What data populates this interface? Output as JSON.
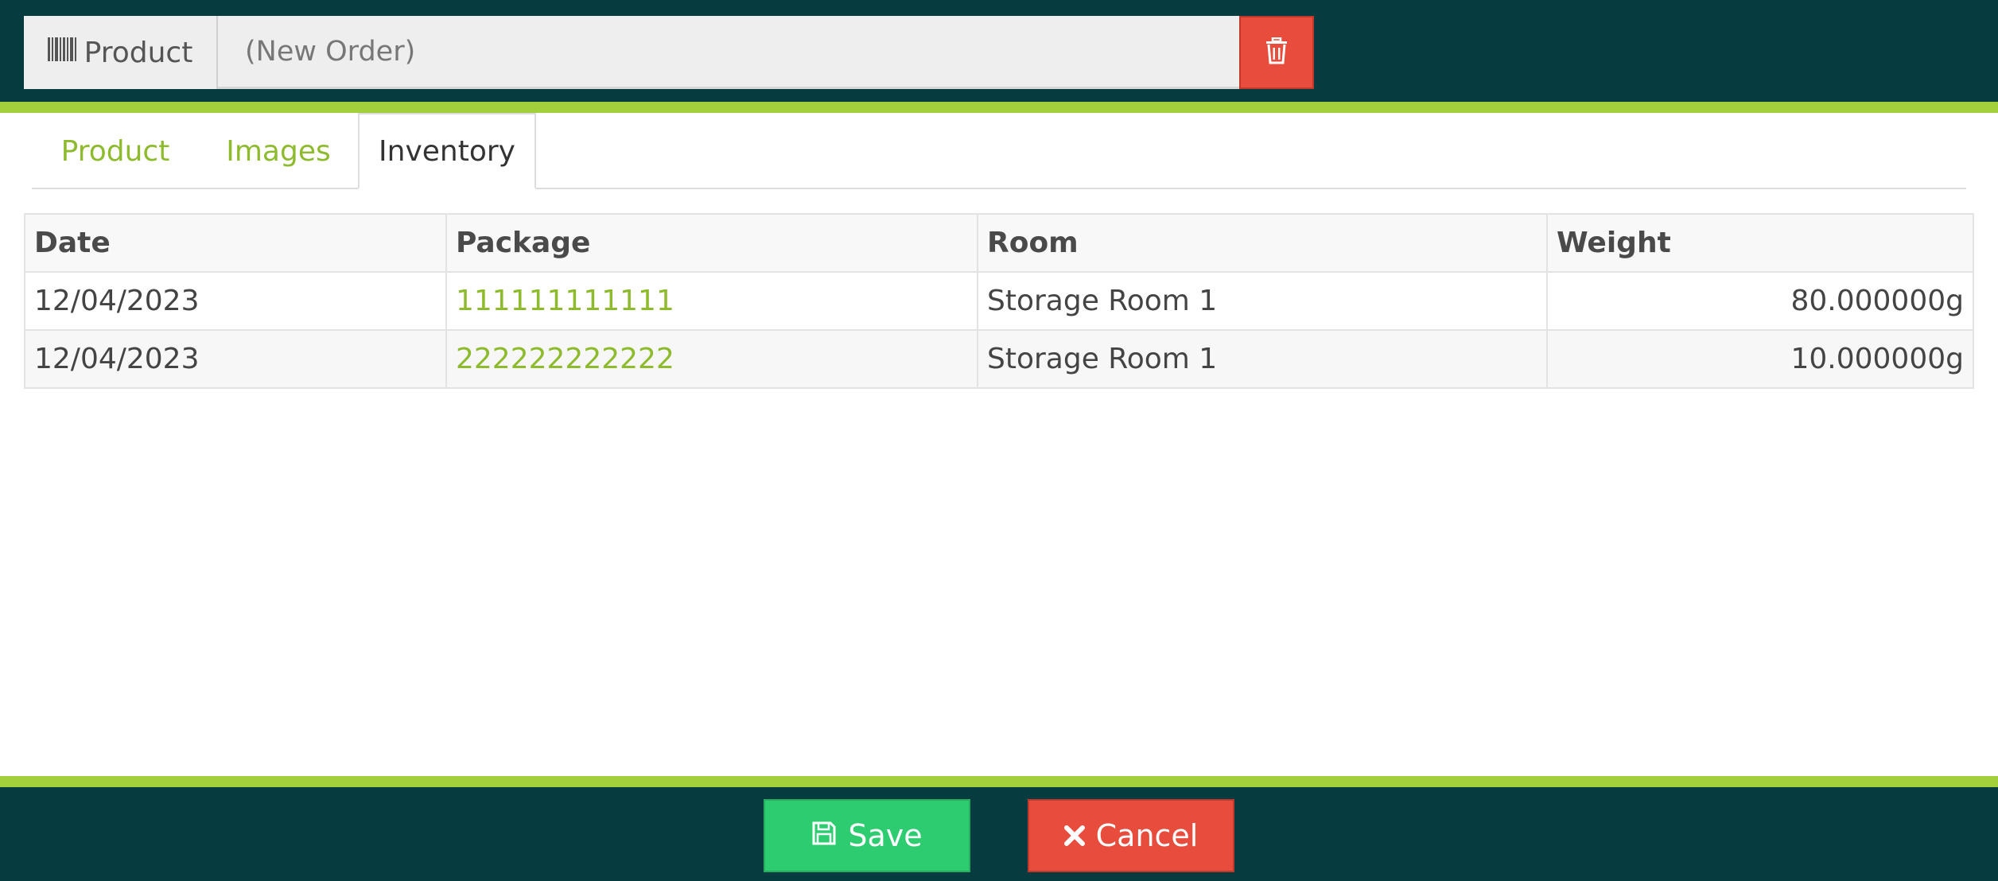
{
  "header": {
    "product_addon_label": "Product",
    "product_placeholder": "(New Order)"
  },
  "tabs": [
    {
      "label": "Product",
      "active": false
    },
    {
      "label": "Images",
      "active": false
    },
    {
      "label": "Inventory",
      "active": true
    }
  ],
  "table": {
    "columns": [
      "Date",
      "Package",
      "Room",
      "Weight"
    ],
    "rows": [
      {
        "date": "12/04/2023",
        "package": "111111111111",
        "room": "Storage Room 1",
        "weight": "80.000000g"
      },
      {
        "date": "12/04/2023",
        "package": "222222222222",
        "room": "Storage Room 1",
        "weight": "10.000000g"
      }
    ]
  },
  "footer": {
    "save_label": "Save",
    "cancel_label": "Cancel"
  },
  "colors": {
    "header_bg": "#063b3f",
    "accent_green": "#a3cf3c",
    "link_green": "#8dbb2d",
    "save_green": "#2ecc71",
    "danger_red": "#e74c3c"
  }
}
